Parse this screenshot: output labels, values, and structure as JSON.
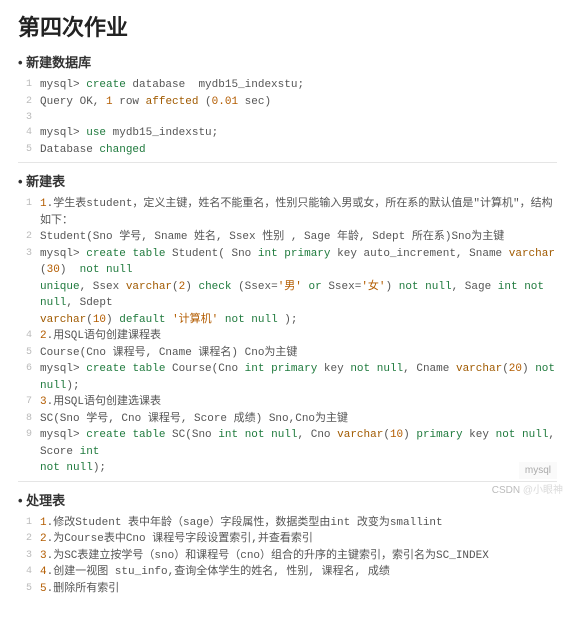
{
  "title": "第四次作业",
  "sections": {
    "s1": {
      "heading": "新建数据库"
    },
    "s2": {
      "heading": "新建表"
    },
    "s3": {
      "heading": "处理表"
    }
  },
  "code1": {
    "l1_a": "mysql> ",
    "l1_b": "create",
    "l1_c": " database  mydb15_indexstu;",
    "l2_a": "Query OK, ",
    "l2_b": "1",
    "l2_c": " row ",
    "l2_d": "affected",
    "l2_e": " (",
    "l2_f": "0.01",
    "l2_g": " sec)",
    "l3": "",
    "l4_a": "mysql> ",
    "l4_b": "use",
    "l4_c": " mydb15_indexstu;",
    "l5_a": "Database ",
    "l5_b": "changed"
  },
  "code2": {
    "l1_a": "1",
    "l1_b": ".学生表student，定义主键，姓名不能重名，性别只能输入男或女，所在系的默认值是\"计算机\"，结构如下：",
    "l2": "Student(Sno 学号, Sname 姓名, Ssex 性别 , Sage 年龄, Sdept 所在系)Sno为主键",
    "l3_a": "mysql> ",
    "l3_b": "create",
    "l3_c": " ",
    "l3_d": "table",
    "l3_e": " Student( Sno ",
    "l3_f": "int",
    "l3_g": " ",
    "l3_h": "primary",
    "l3_i": " key auto_increment, Sname ",
    "l3_j": "varchar",
    "l3_k": "(",
    "l3_l": "30",
    "l3_m": ") ",
    "l3_n": " not",
    "l3_o": " ",
    "l3_p": "null",
    "l3b_a": "unique",
    "l3b_b": ", Ssex ",
    "l3b_c": "varchar",
    "l3b_d": "(",
    "l3b_e": "2",
    "l3b_f": ") ",
    "l3b_g": "check",
    "l3b_h": " (Ssex=",
    "l3b_i": "'男'",
    "l3b_j": " ",
    "l3b_k": "or",
    "l3b_l": " Ssex=",
    "l3b_m": "'女'",
    "l3b_n": ") ",
    "l3b_o": "not",
    "l3b_p": " ",
    "l3b_q": "null",
    "l3b_r": ", Sage ",
    "l3b_s": "int",
    "l3b_t": " ",
    "l3b_u": "not",
    "l3b_v": " ",
    "l3b_w": "null",
    "l3b_x": ", Sdept",
    "l3c_a": "varchar",
    "l3c_b": "(",
    "l3c_c": "10",
    "l3c_d": ") ",
    "l3c_e": "default",
    "l3c_f": " ",
    "l3c_g": "'计算机'",
    "l3c_h": " ",
    "l3c_i": "not",
    "l3c_j": " ",
    "l3c_k": "null",
    "l3c_l": " );",
    "l4_a": "2",
    "l4_b": ".用SQL语句创建课程表",
    "l5": "Course(Cno 课程号, Cname 课程名) Cno为主键",
    "l6_a": "mysql> ",
    "l6_b": "create",
    "l6_c": " ",
    "l6_d": "table",
    "l6_e": " Course(Cno ",
    "l6_f": "int",
    "l6_g": " ",
    "l6_h": "primary",
    "l6_i": " key ",
    "l6_j": "not",
    "l6_k": " ",
    "l6_l": "null",
    "l6_m": ", Cname ",
    "l6_n": "varchar",
    "l6_o": "(",
    "l6_p": "20",
    "l6_q": ") ",
    "l6_r": "not",
    "l6_s": " ",
    "l6_t": "null",
    "l6_u": ");",
    "l7_a": "3",
    "l7_b": ".用SQL语句创建选课表",
    "l8": "SC(Sno 学号, Cno 课程号, Score 成绩) Sno,Cno为主键",
    "l9_a": "mysql> ",
    "l9_b": "create",
    "l9_c": " ",
    "l9_d": "table",
    "l9_e": " SC(Sno ",
    "l9_f": "int",
    "l9_g": " ",
    "l9_h": "not",
    "l9_i": " ",
    "l9_j": "null",
    "l9_k": ", Cno ",
    "l9_l": "varchar",
    "l9_m": "(",
    "l9_n": "10",
    "l9_o": ") ",
    "l9_p": "primary",
    "l9_q": " key ",
    "l9_r": "not",
    "l9_s": " ",
    "l9_t": "null",
    "l9_u": ", Score ",
    "l9_v": "int",
    "l9b_a": "not",
    "l9b_b": " ",
    "l9b_c": "null",
    "l9b_d": ");"
  },
  "tag": "mysql",
  "code3": {
    "l1_a": "1",
    "l1_b": ".修改Student 表中年龄（sage）字段属性，数据类型由int 改变为smallint",
    "l2_a": "2",
    "l2_b": ".为Course表中Cno 课程号字段设置索引,并查看索引",
    "l3_a": "3",
    "l3_b": ".为SC表建立按学号（sno）和课程号（cno）组合的升序的主键索引，索引名为SC_INDEX",
    "l4_a": "4",
    "l4_b": ".创建一视图 stu_info,查询全体学生的姓名, 性别, 课程名, 成绩",
    "l5_a": "5",
    "l5_b": ".删除所有索引"
  },
  "footer_a": "CSDN ",
  "footer_b": "@小眼神"
}
